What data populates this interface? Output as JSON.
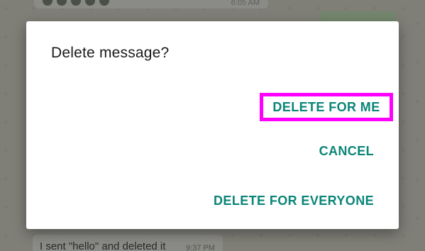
{
  "background_chat": {
    "top_bubble_time": "6:05 AM",
    "bottom_bubble_text": "I sent \"hello\" and deleted it",
    "bottom_bubble_time": "9:37 PM"
  },
  "dialog": {
    "title": "Delete message?",
    "actions": {
      "delete_for_me": "DELETE FOR ME",
      "cancel": "CANCEL",
      "delete_for_everyone": "DELETE FOR EVERYONE"
    }
  },
  "colors": {
    "accent": "#0a8577",
    "highlight": "#ff00ff",
    "dialog_bg": "#ffffff"
  }
}
